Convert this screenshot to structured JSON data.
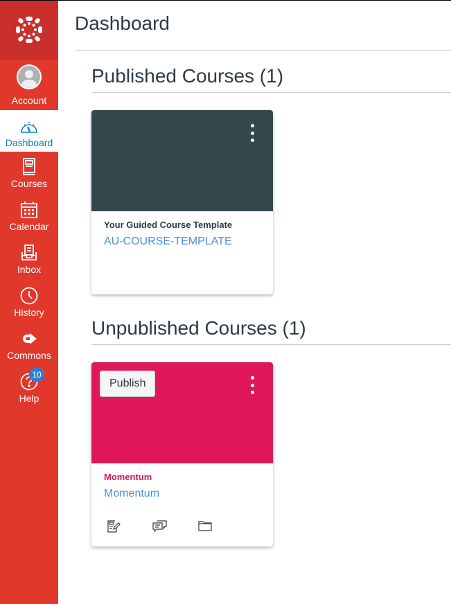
{
  "sidebar": {
    "logo_icon": "canvas-logo-icon",
    "items": [
      {
        "label": "Account",
        "icon": "avatar-icon"
      },
      {
        "label": "Dashboard",
        "icon": "dashboard-gauge-icon",
        "active": true
      },
      {
        "label": "Courses",
        "icon": "book-icon"
      },
      {
        "label": "Calendar",
        "icon": "calendar-icon"
      },
      {
        "label": "Inbox",
        "icon": "inbox-icon"
      },
      {
        "label": "History",
        "icon": "clock-icon"
      },
      {
        "label": "Commons",
        "icon": "commons-icon"
      },
      {
        "label": "Help",
        "icon": "help-icon",
        "badge": "10"
      }
    ]
  },
  "main": {
    "page_title": "Dashboard",
    "sections": [
      {
        "title": "Published Courses (1)",
        "courses": [
          {
            "name": "Your Guided Course Template",
            "code": "AU-COURSE-TEMPLATE",
            "color": "#34474d",
            "name_color": "#2d3b45",
            "menu_icon": "kebab-menu-icon"
          }
        ]
      },
      {
        "title": "Unpublished Courses (1)",
        "courses": [
          {
            "name": "Momentum",
            "code": "Momentum",
            "color": "#e0185a",
            "name_color": "#d61a58",
            "publish_label": "Publish",
            "menu_icon": "kebab-menu-icon",
            "actions": [
              {
                "icon": "assignments-icon"
              },
              {
                "icon": "discussions-icon"
              },
              {
                "icon": "files-folder-icon"
              }
            ]
          }
        ]
      }
    ]
  },
  "colors": {
    "sidebar_bg": "#e0392c",
    "logo_bg": "#c9302b",
    "active_text": "#0f7cc0",
    "link": "#4a90d9",
    "badge": "#2d7fd3"
  }
}
